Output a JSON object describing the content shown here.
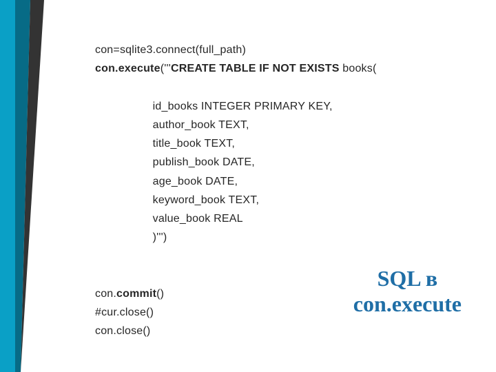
{
  "code": {
    "l1_a": "con=sqlite3.connect(full_path)",
    "l2_a": "con.execute",
    "l2_b": "('''",
    "l2_c": "CREATE TABLE IF NOT EXISTS",
    "l2_d": " books(",
    "col1": "id_books INTEGER PRIMARY KEY,",
    "col2": "author_book TEXT,",
    "col3": "title_book TEXT,",
    "col4": "publish_book DATE,",
    "col5": "age_book DATE,",
    "col6": "keyword_book TEXT,",
    "col7": "value_book REAL",
    "col8": ")''')",
    "c1_a": "con.",
    "c1_b": "commit",
    "c1_c": "()",
    "c2": "#cur.close()",
    "c3": "con.close()"
  },
  "heading": {
    "line1": "SQL в",
    "line2": "con.execute"
  }
}
